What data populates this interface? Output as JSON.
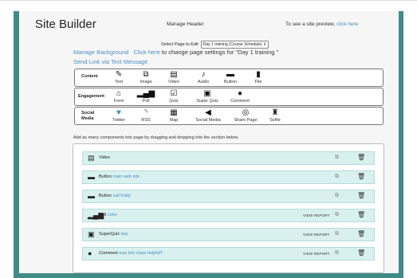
{
  "header": {
    "title": "Site Builder",
    "manage_header": "Manage Header",
    "preview_text": "To see a site preview,",
    "preview_link": "click here"
  },
  "page_select": {
    "label": "Select Page to Edit",
    "selected": "Day 1 training (Course Schedule)"
  },
  "background": {
    "manage_link": "Manage Background",
    "click_here": "Click here",
    "settings_text": "to change page settings for \"Day 1 training \"",
    "send_link": "Send Link via Text Message"
  },
  "toolbars": {
    "content": {
      "label": "Content",
      "items": [
        {
          "label": "Text",
          "icon": "edit-icon"
        },
        {
          "label": "Image",
          "icon": "image-icon"
        },
        {
          "label": "Video",
          "icon": "video-icon"
        },
        {
          "label": "Audio",
          "icon": "music-icon"
        },
        {
          "label": "Button",
          "icon": "button-icon"
        },
        {
          "label": "File",
          "icon": "file-icon"
        }
      ]
    },
    "engagement": {
      "label": "Engagement",
      "items": [
        {
          "label": "Form",
          "icon": "inbox-icon"
        },
        {
          "label": "Poll",
          "icon": "bar-chart-icon"
        },
        {
          "label": "Quiz",
          "icon": "checkbox-icon"
        },
        {
          "label": "Super Quiz",
          "icon": "clipboard-icon"
        },
        {
          "label": "Comment",
          "icon": "speech-bubble-icon"
        }
      ]
    },
    "social": {
      "label_line1": "Social",
      "label_line2": "Media",
      "items": [
        {
          "label": "Twitter",
          "icon": "twitter-icon"
        },
        {
          "label": "RSS",
          "icon": "rss-icon"
        },
        {
          "label": "Map",
          "icon": "map-icon"
        },
        {
          "label": "Social Media",
          "icon": "megaphone-icon"
        },
        {
          "label": "Share Page",
          "icon": "share-icon"
        },
        {
          "label": "Selfie",
          "icon": "selfie-icon"
        }
      ]
    }
  },
  "instructions": "Add as many components into page by dragging and dropping into the section below.",
  "components": [
    {
      "type": "Video",
      "sub": "",
      "report": "",
      "icon": "video-icon"
    },
    {
      "type": "Button",
      "sub": "main web site",
      "report": "",
      "icon": "button-icon"
    },
    {
      "type": "Button",
      "sub": "call Patty",
      "report": "",
      "icon": "button-icon"
    },
    {
      "type": "Poll",
      "sub": "color",
      "report": "VIEW REPORT",
      "icon": "bar-chart-icon"
    },
    {
      "type": "SuperQuiz",
      "sub": "day",
      "report": "VIEW REPORT",
      "icon": "clipboard-icon"
    },
    {
      "type": "Comment",
      "sub": "was this class helpful?",
      "report": "VIEW REPORT",
      "icon": "speech-bubble-icon"
    }
  ],
  "colors": {
    "frame": "#3f8c86",
    "component_bg": "#d8f0ee",
    "link": "#4a90c2",
    "twitter": "#3d8ed0"
  }
}
